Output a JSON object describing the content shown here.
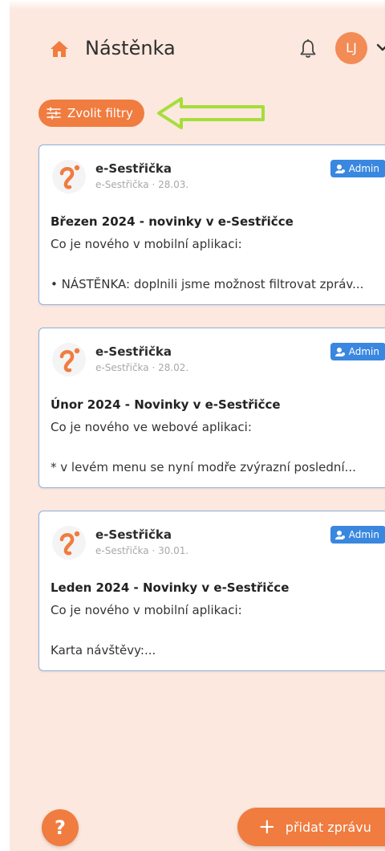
{
  "header": {
    "title": "Nástěnka",
    "avatar_initials": "LJ",
    "icons": [
      "home-icon",
      "bell-icon",
      "chevron-down-icon"
    ]
  },
  "filter": {
    "label": "Zvolit filtry",
    "icon": "sliders-icon"
  },
  "colors": {
    "accent": "#f07c40",
    "background": "#fce8de",
    "admin_badge": "#3a87e0",
    "card_border": "#8fb0dc",
    "arrow": "#a6dd3a"
  },
  "posts": [
    {
      "author": "e-Sestřička",
      "meta": "e-Sestřička · 28.03.",
      "badge": "Admin",
      "title": "Březen 2024 - novinky v e-Sestřičce",
      "line1": "Co je nového v mobilní aplikaci:",
      "line2": "• NÁSTĚNKA: doplnili jsme možnost filtrovat zpráv..."
    },
    {
      "author": "e-Sestřička",
      "meta": "e-Sestřička · 28.02.",
      "badge": "Admin",
      "title": "Únor 2024 - Novinky v e-Sestřičce",
      "line1": "Co je nového ve webové aplikaci:",
      "line2": "* v levém menu se nyní modře zvýrazní poslední..."
    },
    {
      "author": "e-Sestřička",
      "meta": "e-Sestřička · 30.01.",
      "badge": "Admin",
      "title": "Leden 2024 - Novinky v e-Sestřičce",
      "line1": "Co je nového v mobilní aplikaci:",
      "line2": "Karta návštěvy:..."
    }
  ],
  "help": {
    "label": "?"
  },
  "add_post": {
    "label": "přidat zprávu",
    "icon": "plus-icon"
  }
}
